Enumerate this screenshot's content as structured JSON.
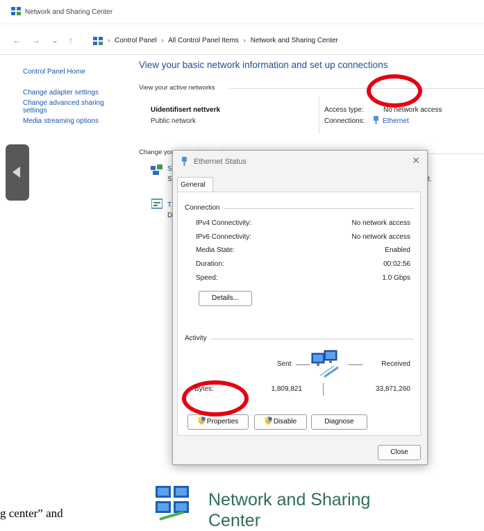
{
  "window": {
    "title": "Network and Sharing Center",
    "icon": "network-icon"
  },
  "nav": {
    "back": "←",
    "forward": "→",
    "recent": "⌄",
    "up": "↑"
  },
  "breadcrumb": {
    "sep": "›",
    "items": [
      "Control Panel",
      "All Control Panel Items",
      "Network and Sharing Center"
    ]
  },
  "sidebar": {
    "items": [
      "Control Panel Home",
      "Change adapter settings",
      "Change advanced sharing",
      "settings",
      "Media streaming options"
    ]
  },
  "main": {
    "heading": "View your basic network information and set up connections",
    "active_networks_label": "View your active networks",
    "network_name": "Uidentifisert nettverk",
    "network_category": "Public network",
    "access_type_label": "Access type:",
    "access_type_value": "No network access",
    "connections_label": "Connections:",
    "connections_value": "Ethernet",
    "change_settings_label": "Change your networking settings",
    "fragment_s1": "S",
    "fragment_s2": "S",
    "fragment_t": "T",
    "fragment_d": "D",
    "fragment_end": "t."
  },
  "dialog": {
    "title": "Ethernet Status",
    "close_glyph": "✕",
    "tab": "General",
    "connection": {
      "label": "Connection",
      "rows": [
        {
          "label": "IPv4 Connectivity:",
          "value": "No network access"
        },
        {
          "label": "IPv6 Connectivity:",
          "value": "No network access"
        },
        {
          "label": "Media State:",
          "value": "Enabled"
        },
        {
          "label": "Duration:",
          "value": "00:02:56"
        },
        {
          "label": "Speed:",
          "value": "1.0 Gbps"
        }
      ]
    },
    "details_button": "Details...",
    "activity": {
      "label": "Activity",
      "sent_label": "Sent",
      "received_label": "Received",
      "bytes_label": "Bytes:",
      "bytes_sent": "1,809,821",
      "bytes_received": "33,871,260"
    },
    "properties_button": "Properties",
    "disable_button": "Disable",
    "diagnose_button": "Diagnose",
    "close_button": "Close"
  },
  "footer": {
    "big_label_line1": "Network and Sharing",
    "big_label_line2": "Center",
    "cut_text": "g center” and"
  },
  "colors": {
    "link": "#1a56a8",
    "heading": "#1e4e95",
    "annotation_red": "#e60012",
    "big_label": "#2d6e5a"
  }
}
